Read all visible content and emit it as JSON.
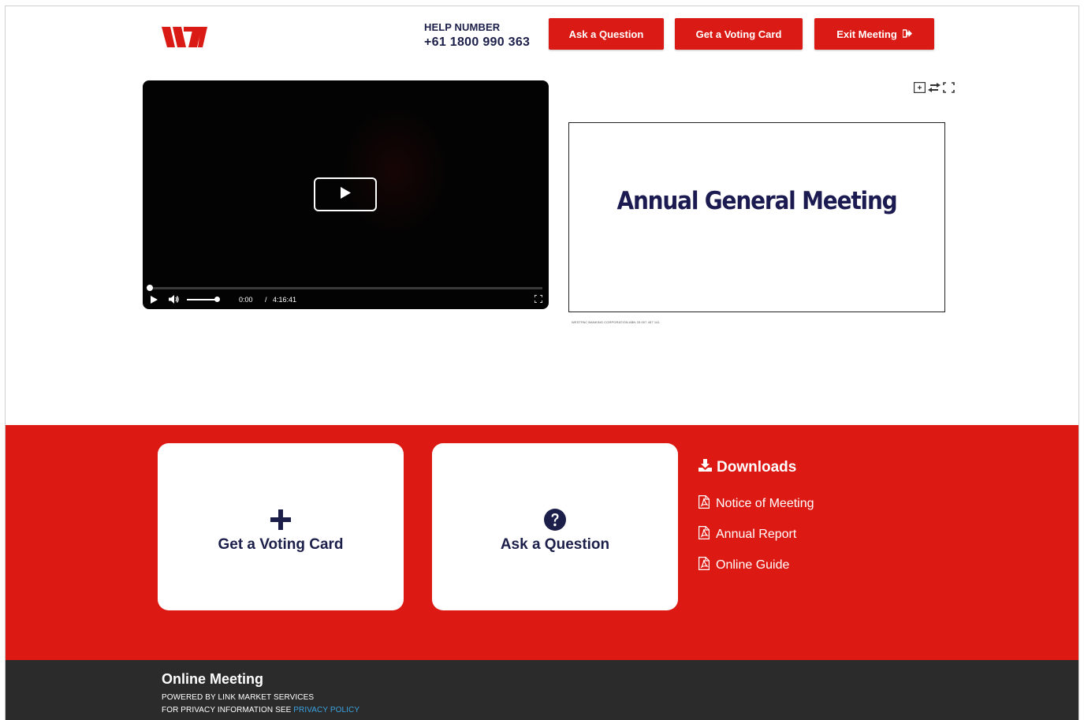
{
  "header": {
    "logo_icon": "westpac-w-logo",
    "help_label": "HELP NUMBER",
    "help_number": "+61 1800 990 363",
    "buttons": {
      "ask_question": "Ask a Question",
      "voting_card": "Get a Voting Card",
      "exit_meeting": "Exit Meeting"
    },
    "exit_icon": "sign-out-icon"
  },
  "video": {
    "current_time": "0:00",
    "separator": "/",
    "duration": "4:16:41",
    "progress": 0,
    "volume": 1.0
  },
  "slide": {
    "title": "Annual General Meeting",
    "footer_text": "WESTPAC BANKING CORPORATION ABN 33 007 457 141",
    "tools": [
      "picture-in-picture-icon",
      "swap-icon",
      "fullscreen-icon"
    ]
  },
  "actions": {
    "voting_card": "Get a Voting Card",
    "ask_question": "Ask a Question"
  },
  "downloads": {
    "title": "Downloads",
    "items": [
      {
        "label": "Notice of Meeting",
        "icon": "pdf-icon"
      },
      {
        "label": "Annual Report",
        "icon": "pdf-icon"
      },
      {
        "label": "Online Guide",
        "icon": "pdf-icon"
      }
    ]
  },
  "footer": {
    "title": "Online Meeting",
    "powered_by": "POWERED BY LINK MARKET SERVICES",
    "privacy_prefix": "FOR PRIVACY INFORMATION SEE",
    "privacy_link": "PRIVACY POLICY"
  },
  "colors": {
    "brand_red": "#da1a14",
    "navy": "#1c1f4a",
    "footer_bg": "#2b2b2b",
    "link_blue": "#3ba3e0"
  }
}
